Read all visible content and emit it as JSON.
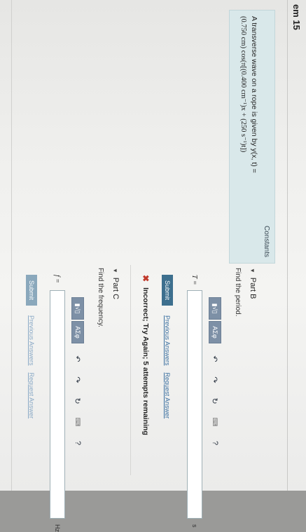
{
  "header": {
    "title": "em 15"
  },
  "constants_panel": {
    "link": "Constants",
    "text": "A transverse wave on a rope is given by y(x, t) =",
    "equation": "(0.750 cm) cos(π[(0.400 cm⁻¹)x + (250 s⁻¹)t])"
  },
  "part_b": {
    "title": "Part B",
    "prompt": "Find the period.",
    "variable": "T =",
    "unit": "s",
    "submit_label": "Submit",
    "previous_answers": "Previous Answers",
    "request_answer": "Request Answer",
    "feedback": "Incorrect; Try Again; 5 attempts remaining"
  },
  "part_c": {
    "title": "Part C",
    "prompt": "Find the frequency.",
    "variable": "f =",
    "unit": "Hz",
    "submit_label": "Submit",
    "previous_answers": "Previous Answers",
    "request_answer": "Request Answer"
  },
  "toolbar": {
    "sqrt_label": "▮√▯",
    "greek_label": "ΑΣφ",
    "undo_icon": "↶",
    "redo_icon": "↷",
    "reset_icon": "↻",
    "keyboard_icon": "⌨",
    "help_icon": "?"
  }
}
